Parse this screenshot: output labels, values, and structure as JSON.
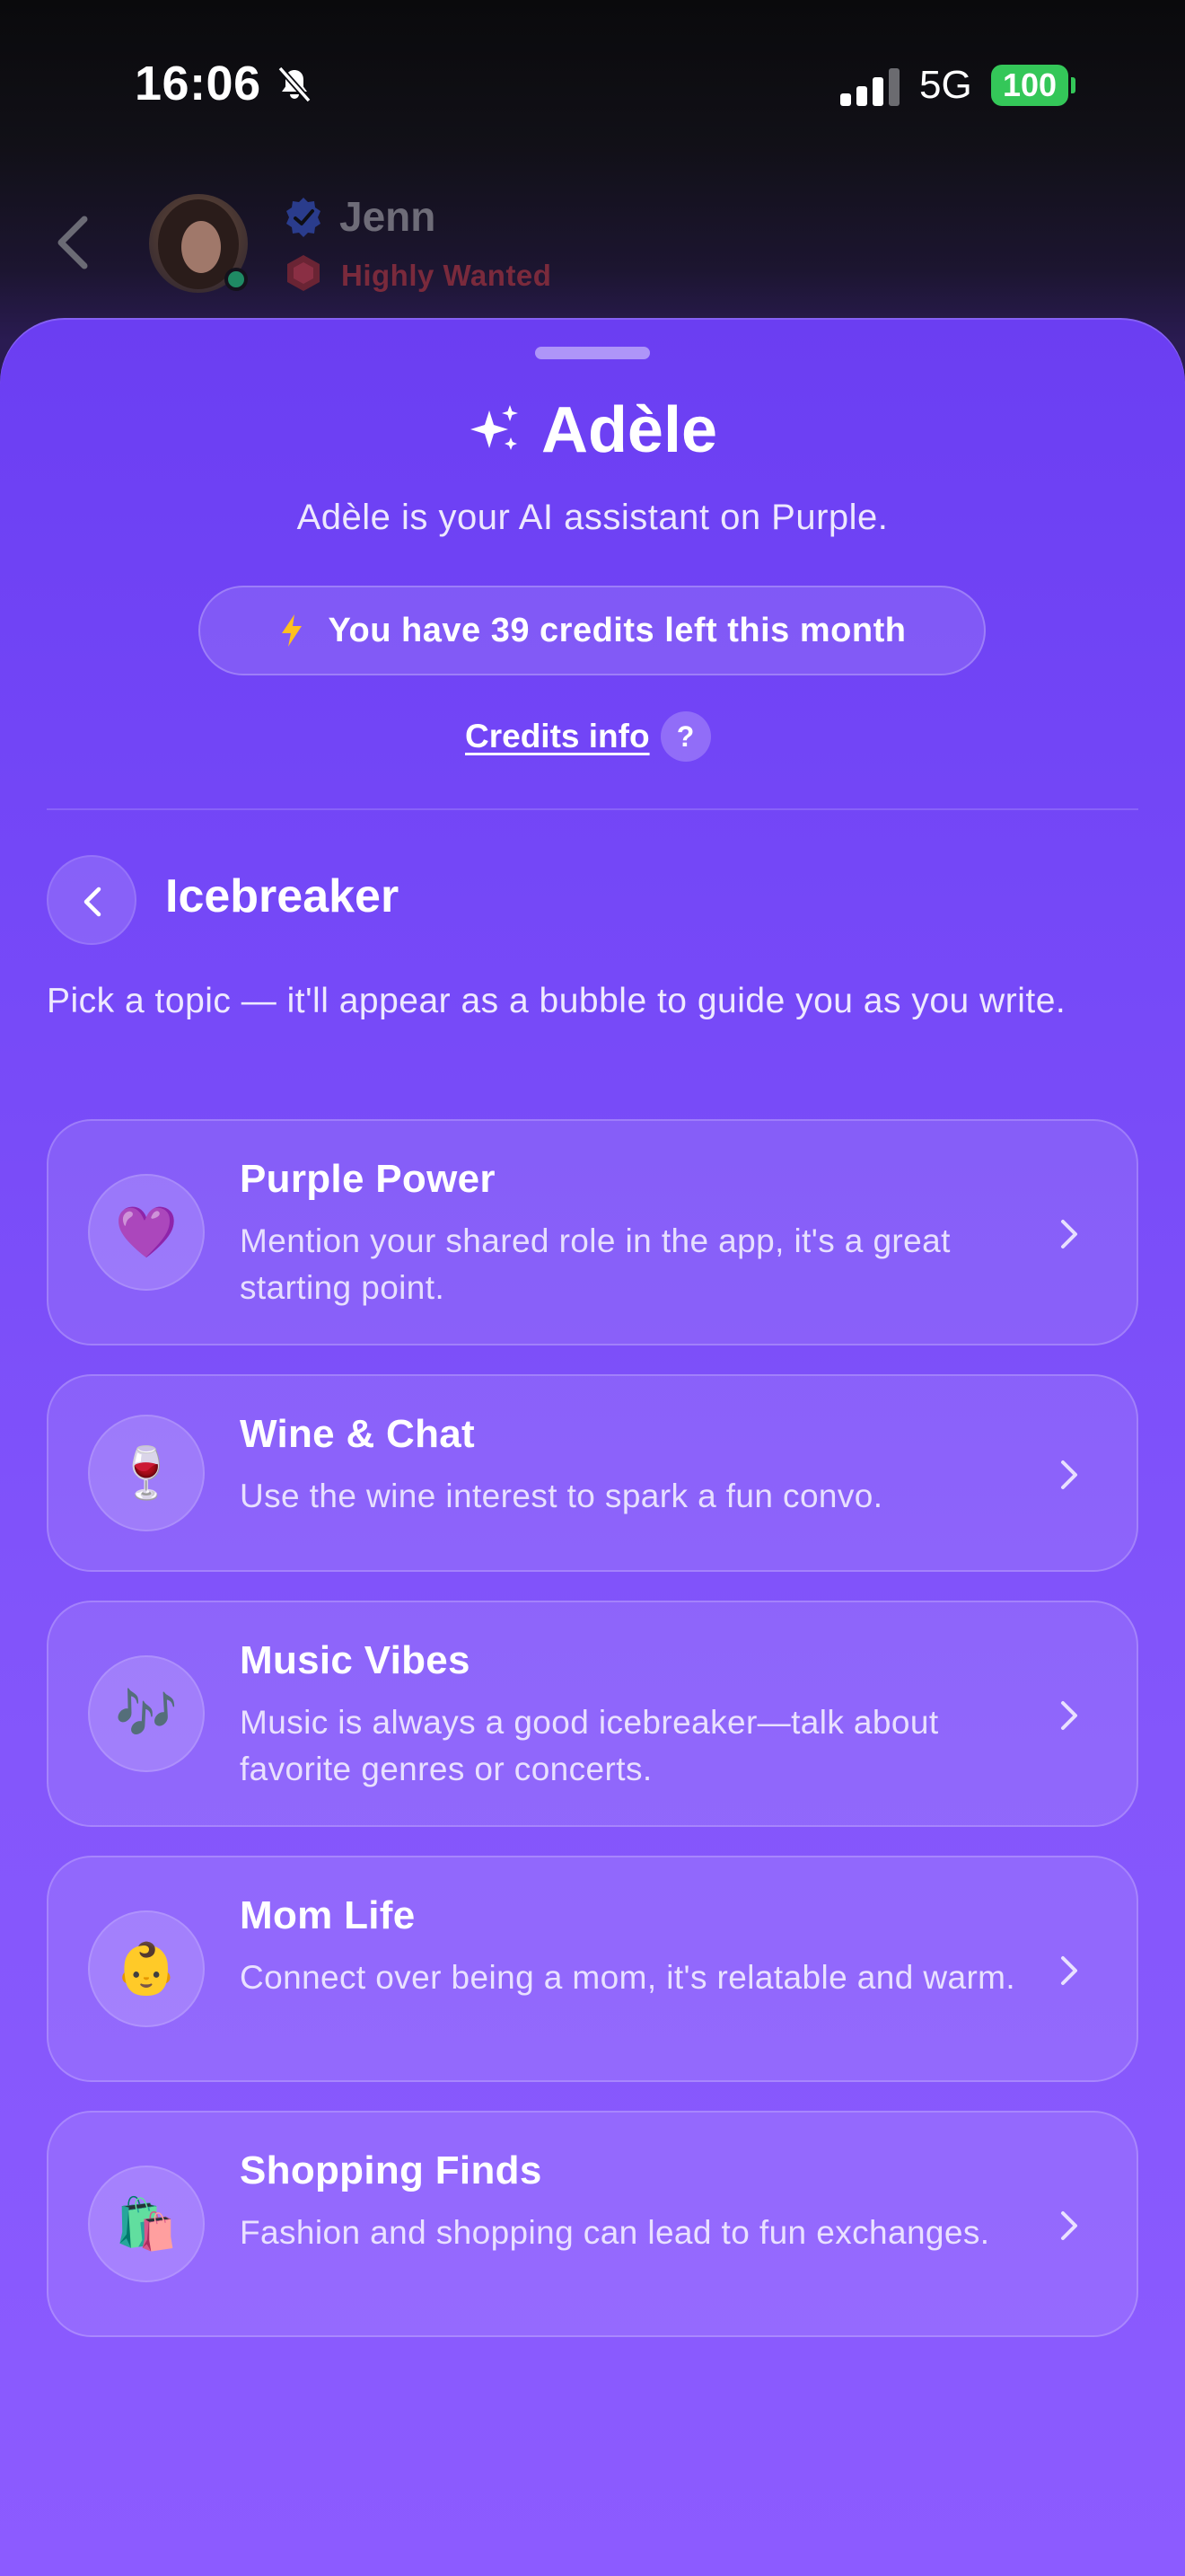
{
  "status_bar": {
    "time": "16:06",
    "network": "5G",
    "battery": "100",
    "colors": {
      "battery": "#34c759"
    }
  },
  "chat_header": {
    "name": "Jenn",
    "tag": "Highly Wanted"
  },
  "sheet": {
    "title": "Adèle",
    "subtitle": "Adèle is your AI assistant on Purple.",
    "credits_text": "You have 39 credits left this month",
    "credits_info_label": "Credits info",
    "help_glyph": "?",
    "accent": "#7447f7"
  },
  "section": {
    "title": "Icebreaker",
    "description": "Pick a topic — it'll appear as a bubble to guide you as you write."
  },
  "topics": [
    {
      "icon": "💜",
      "icon_name": "purple-heart-icon",
      "title": "Purple Power",
      "description": "Mention your shared role in the app, it's a great starting point."
    },
    {
      "icon": "🍷",
      "icon_name": "wine-glass-icon",
      "title": "Wine & Chat",
      "description": "Use the wine interest to spark a fun convo."
    },
    {
      "icon": "🎶",
      "icon_name": "music-notes-icon",
      "title": "Music Vibes",
      "description": "Music is always a good icebreaker—talk about favorite genres or concerts."
    },
    {
      "icon": "👶",
      "icon_name": "baby-icon",
      "title": "Mom Life",
      "description": "Connect over being a mom, it's relatable and warm."
    },
    {
      "icon": "🛍️",
      "icon_name": "shopping-bags-icon",
      "title": "Shopping Finds",
      "description": "Fashion and shopping can lead to fun exchanges."
    }
  ]
}
